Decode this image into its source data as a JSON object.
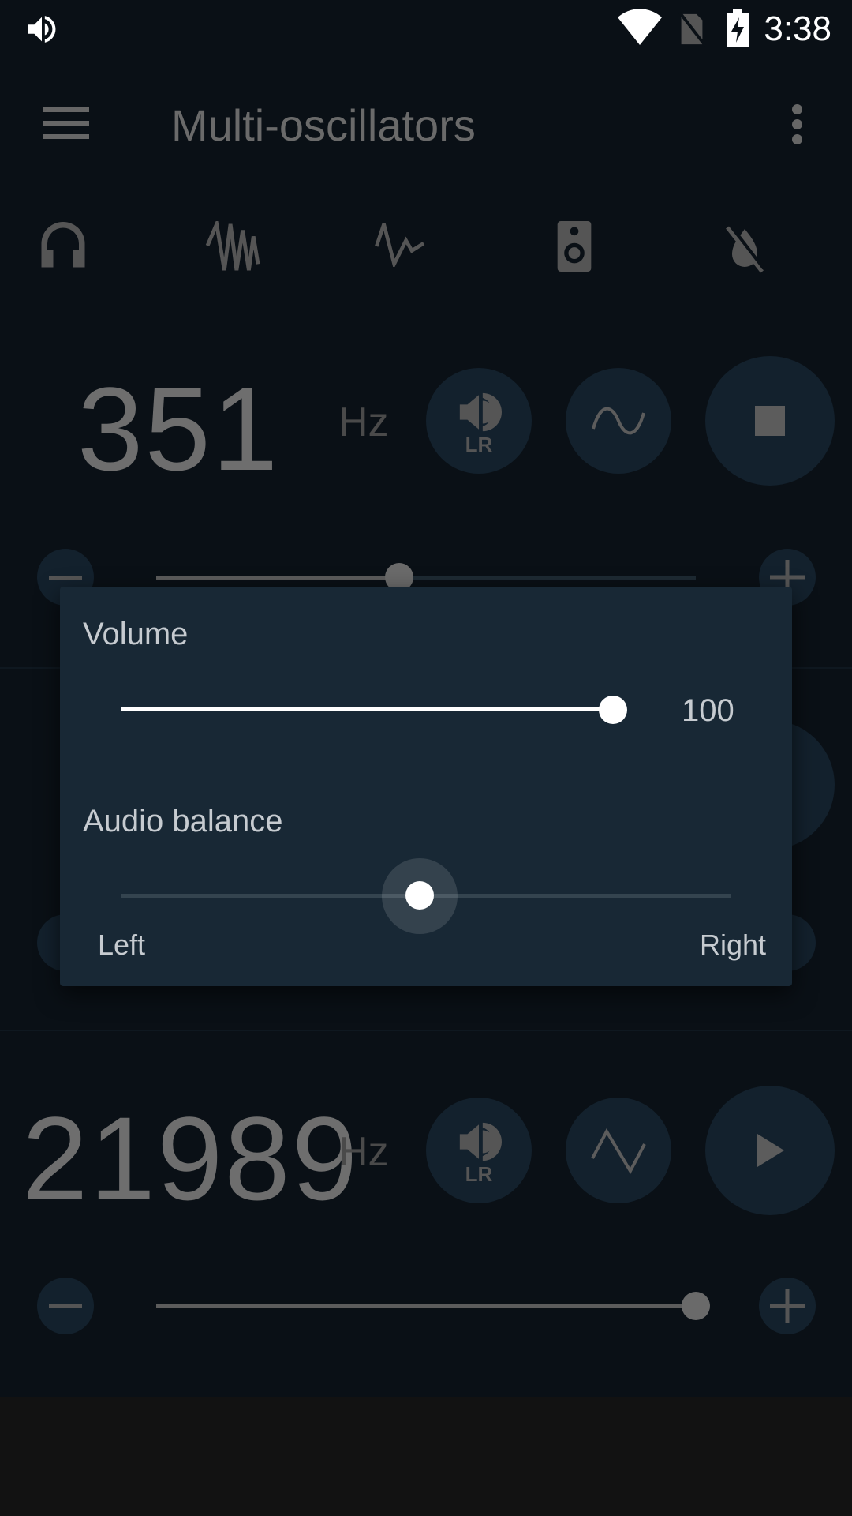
{
  "status_bar": {
    "time": "3:38",
    "icons": [
      "volume-icon",
      "wifi-icon",
      "no-sim-icon",
      "battery-charging-icon"
    ]
  },
  "toolbar": {
    "title": "Multi-oscillators",
    "menu_icon": "hamburger-icon",
    "overflow_icon": "more-vert-icon"
  },
  "mode_icons": [
    "headphones-icon",
    "noise-icon",
    "pulse-icon",
    "speaker-icon",
    "mute-off-icon"
  ],
  "oscillators": [
    {
      "frequency": "351",
      "unit": "Hz",
      "channel_badge": "LR",
      "waveform": "sine",
      "state_icon": "stop-icon",
      "slider_percent": 45
    },
    {
      "frequency": "21989",
      "unit": "Hz",
      "channel_badge": "LR",
      "waveform": "triangle",
      "state_icon": "play-icon",
      "slider_percent": 100
    }
  ],
  "dialog": {
    "volume_label": "Volume",
    "volume_value": "100",
    "volume_percent": 100,
    "balance_label": "Audio balance",
    "balance_left": "Left",
    "balance_right": "Right",
    "balance_percent": 49
  },
  "colors": {
    "background": "#0a1016",
    "dialog": "#182835",
    "button": "#13212d"
  }
}
